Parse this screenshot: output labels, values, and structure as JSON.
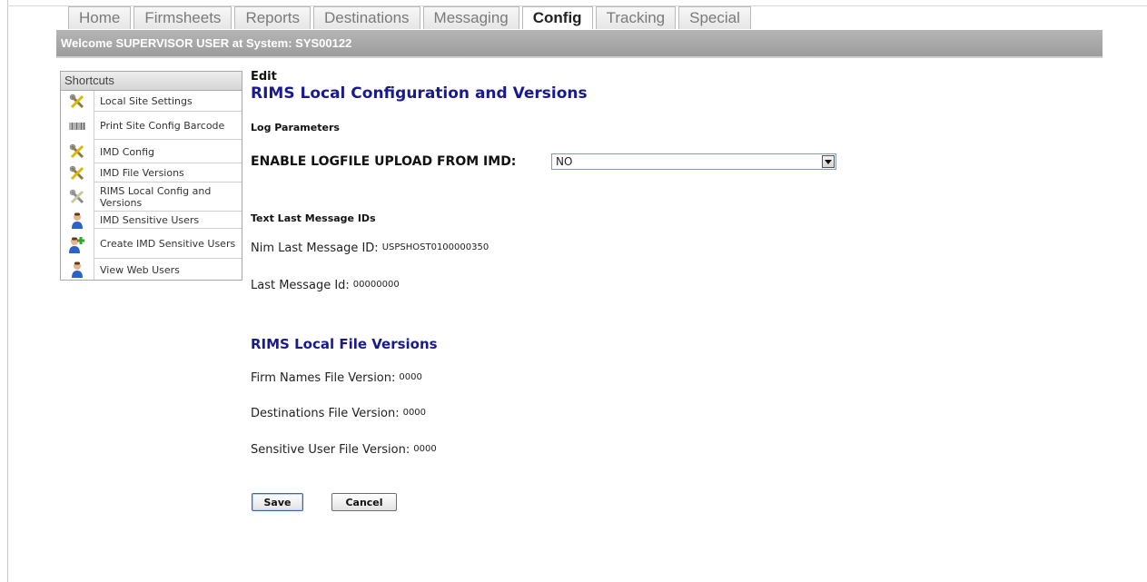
{
  "tabs": [
    {
      "label": "Home",
      "active": false
    },
    {
      "label": "Firmsheets",
      "active": false
    },
    {
      "label": "Reports",
      "active": false
    },
    {
      "label": "Destinations",
      "active": false
    },
    {
      "label": "Messaging",
      "active": false
    },
    {
      "label": "Config",
      "active": true
    },
    {
      "label": "Tracking",
      "active": false
    },
    {
      "label": "Special",
      "active": false
    }
  ],
  "welcome": "Welcome SUPERVISOR USER at System: SYS00122",
  "shortcuts": {
    "title": "Shortcuts",
    "items": [
      {
        "label": "Local Site Settings",
        "icon": "tools-icon"
      },
      {
        "label": "Print Site Config Barcode",
        "icon": "barcode-icon"
      },
      {
        "label": "IMD Config",
        "icon": "tools-icon"
      },
      {
        "label": "IMD File Versions",
        "icon": "tools-icon"
      },
      {
        "label": "RIMS Local Config and Versions",
        "icon": "tools-icon"
      },
      {
        "label": "IMD Sensitive Users",
        "icon": "user-icon"
      },
      {
        "label": "Create IMD Sensitive Users",
        "icon": "add-user-icon"
      },
      {
        "label": "View Web Users",
        "icon": "user-icon"
      }
    ]
  },
  "main": {
    "edit_label": "Edit",
    "title": "RIMS Local Configuration and Versions",
    "log_params_heading": "Log Parameters",
    "enable_logfile_label": "ENABLE LOGFILE UPLOAD FROM IMD:",
    "enable_logfile_value": "NO",
    "text_last_heading": "Text Last Message IDs",
    "nim_last_label": "Nim Last Message ID:",
    "nim_last_value": "USPSHOST0100000350",
    "last_msg_label": "Last Message Id:",
    "last_msg_value": "00000000",
    "file_versions_title": "RIMS Local File Versions",
    "firm_names_label": "Firm Names File Version:",
    "firm_names_value": "0000",
    "destinations_label": "Destinations File Version:",
    "destinations_value": "0000",
    "sensitive_user_label": "Sensitive User File Version:",
    "sensitive_user_value": "0000",
    "save_label": "Save",
    "cancel_label": "Cancel"
  },
  "colors": {
    "heading_blue": "#1a1a8f",
    "welcome_bar": "#a5a5a5"
  }
}
